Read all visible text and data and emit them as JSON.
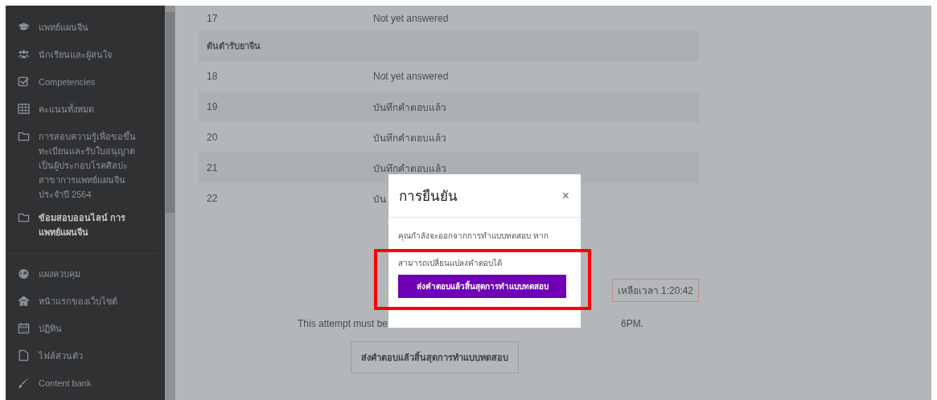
{
  "sidebar": {
    "sections": [
      {
        "items": [
          {
            "label": "แพทย์แผนจีน",
            "selected": false
          },
          {
            "label": "นักเรียนและผู้สนใจ",
            "selected": false
          },
          {
            "label": "Competencies",
            "selected": false
          },
          {
            "label": "คะแนนทั้งหมด",
            "selected": false
          },
          {
            "label": "การสอบความรู้เพื่อขอขึ้นทะเบียนและรับใบอนุญาตเป็นผู้ประกอบโรคศิลปะ สาขาการแพทย์แผนจีน ประจำปี 2564",
            "selected": false
          },
          {
            "label": "ข้อมสอบออนไลน์ การแพทย์แผนจีน",
            "selected": true
          }
        ]
      },
      {
        "items": [
          {
            "label": "แผงควบคุม",
            "selected": false
          },
          {
            "label": "หน้าแรกของเว็บไซต์",
            "selected": false
          },
          {
            "label": "ปฏิทิน",
            "selected": false
          },
          {
            "label": "ไฟล์ส่วนตัว",
            "selected": false
          },
          {
            "label": "Content bank",
            "selected": false
          }
        ]
      }
    ]
  },
  "summary_table": {
    "rows": [
      {
        "kind": "question",
        "number": "17",
        "status": "Not yet answered"
      },
      {
        "kind": "section",
        "title": "ตันตำรับยาจีน"
      },
      {
        "kind": "question",
        "number": "18",
        "status": "Not yet answered"
      },
      {
        "kind": "question",
        "number": "19",
        "status": "บันทึกคำตอบแล้ว"
      },
      {
        "kind": "question",
        "number": "20",
        "status": "บันทึกคำตอบแล้ว"
      },
      {
        "kind": "question",
        "number": "21",
        "status": "บันทึกคำตอบแล้ว"
      },
      {
        "kind": "question",
        "number": "22",
        "status": "บัน"
      }
    ]
  },
  "timer": "เหลือเวลา 1:20:42",
  "attempt_note": {
    "before": "This attempt must be",
    "after": "6PM."
  },
  "submit_button": "ส่งคำตอบแล้วสิ้นสุดการทำแบบทดสอบ",
  "dialog": {
    "title": "การยืนยัน",
    "close": "×",
    "message_lines": [
      "คุณกำลังจะออกจากการทำแบบทดสอบ หาก",
      "สามารถเปลี่ยนแปลงคำตอบได้"
    ],
    "confirm_button": "ส่งคำตอบแล้วสิ้นสุดการทำแบบทดสอบ"
  }
}
